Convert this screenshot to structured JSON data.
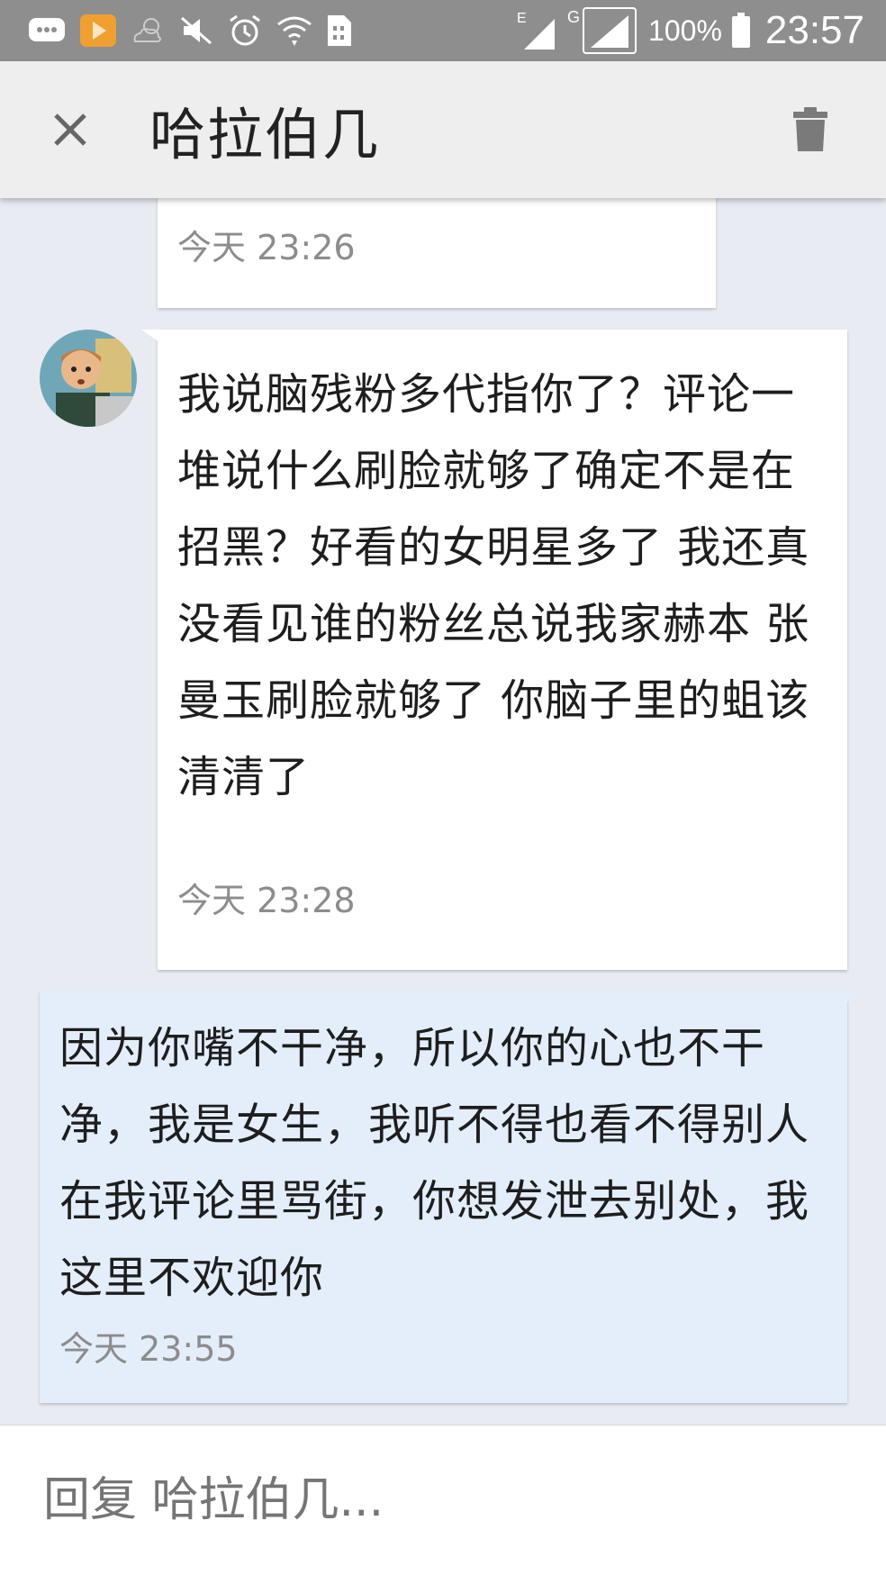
{
  "status_bar": {
    "battery": "100%",
    "time": "23:57",
    "network_e": "E",
    "network_g": "G"
  },
  "header": {
    "title": "哈拉伯几"
  },
  "messages": {
    "m1": {
      "text": "…",
      "time": "今天 23:26"
    },
    "m2": {
      "text": "我说脑残粉多代指你了？评论一堆说什么刷脸就够了确定不是在招黑？好看的女明星多了 我还真没看见谁的粉丝总说我家赫本 张曼玉刷脸就够了 你脑子里的蛆该清清了",
      "time": "今天 23:28"
    },
    "m3": {
      "text": "因为你嘴不干净，所以你的心也不干净，我是女生，我听不得也看不得别人在我评论里骂街，你想发泄去别处，我这里不欢迎你",
      "time": "今天 23:55"
    }
  },
  "reply": {
    "placeholder": "回复 哈拉伯几..."
  },
  "colors": {
    "status_bar": "#8e8e8e",
    "header": "#eeeeee",
    "background": "#e8ebf2",
    "sent_bubble": "#e3eefa",
    "received_bubble": "#ffffff"
  }
}
